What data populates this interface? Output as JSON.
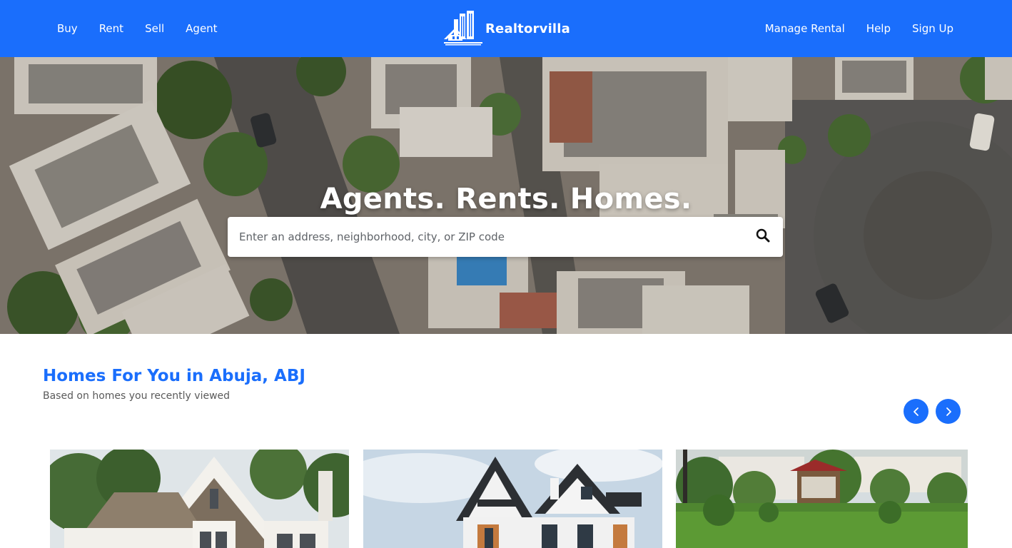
{
  "nav": {
    "left": [
      "Buy",
      "Rent",
      "Sell",
      "Agent"
    ],
    "right": [
      "Manage Rental",
      "Help",
      "Sign Up"
    ],
    "brand": "Realtorvilla"
  },
  "hero": {
    "title": "Agents. Rents. Homes.",
    "search_placeholder": "Enter an address, neighborhood, city, or ZIP code"
  },
  "section": {
    "title": "Homes For You in Abuja, ABJ",
    "subtitle": "Based on homes you recently viewed"
  },
  "icons": {
    "logo": "building-logo-icon",
    "search": "search-icon",
    "prev": "chevron-left-icon",
    "next": "chevron-right-icon"
  },
  "colors": {
    "primary": "#1a6efc",
    "hero_bg": "#7d756c"
  }
}
